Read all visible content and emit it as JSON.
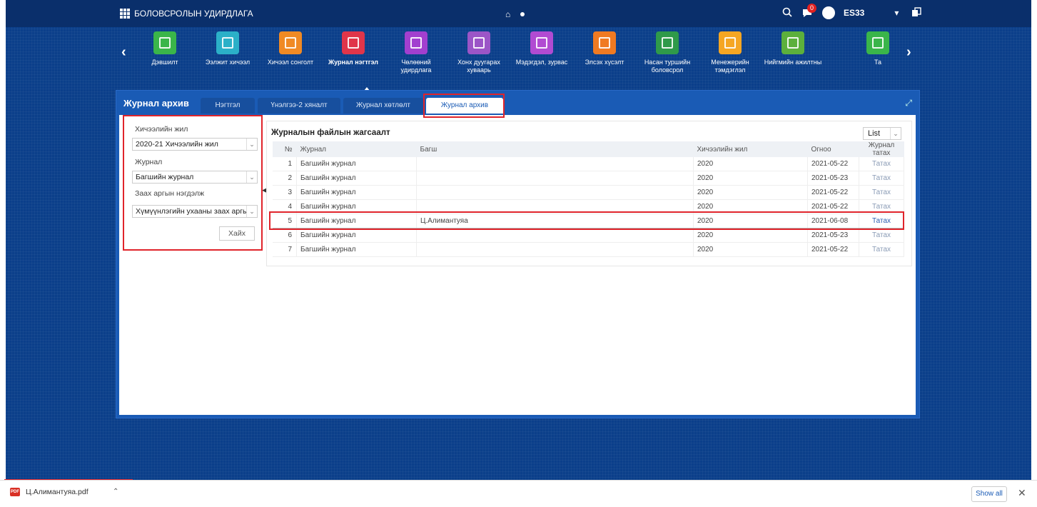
{
  "header": {
    "brand": "БОЛОВСРОЛЫН УДИРДЛАГА",
    "notification_count": "0",
    "user": "ES33"
  },
  "modules": [
    {
      "label": "Дэвшилт",
      "color": "#3ab54a"
    },
    {
      "label": "Ээлжит хичээл",
      "color": "#2bb0c8"
    },
    {
      "label": "Хичээл сонголт",
      "color": "#f08a24"
    },
    {
      "label": "Журнал нэгтгэл",
      "color": "#e0354a"
    },
    {
      "label": "Чөлөөний удирдлага",
      "color": "#a23fcf"
    },
    {
      "label": "Хонх дуугарах хуваарь",
      "color": "#9b55c7"
    },
    {
      "label": "Мэдэгдэл, зурвас",
      "color": "#b14bd2"
    },
    {
      "label": "Элсэх хүсэлт",
      "color": "#f07a22"
    },
    {
      "label": "Насан туршийн боловсрол",
      "color": "#2f9a4a"
    },
    {
      "label": "Менежерийн тэмдэглэл",
      "color": "#f5a623"
    },
    {
      "label": "Нийгмийн ажилтны",
      "color": "#5cb03c"
    },
    {
      "label": "Та",
      "color": "#3ab54a"
    }
  ],
  "panel": {
    "title": "Журнал архив",
    "tabs": [
      "Нэгтгэл",
      "Үнэлгээ-2 хяналт",
      "Журнал хөтлөлт",
      "Журнал архив"
    ]
  },
  "filter": {
    "year_label": "Хичээлийн жил",
    "year_value": "2020-21 Хичээлийн жил",
    "journal_label": "Журнал",
    "journal_value": "Багшийн журнал",
    "method_label": "Заах аргын нэгдэлж",
    "method_value": "Хүмүүнлэгийн ухааны заах аргы",
    "search_button": "Хайх"
  },
  "list": {
    "title": "Журналын файлын жагсаалт",
    "view_mode": "List",
    "columns": [
      "№",
      "Журнал",
      "Багш",
      "Хичээлийн жил",
      "Огноо",
      "Журнал татах"
    ],
    "rows": [
      [
        "1",
        "Багшийн журнал",
        "",
        "2020",
        "2021-05-22",
        "Татах"
      ],
      [
        "2",
        "Багшийн журнал",
        "",
        "2020",
        "2021-05-23",
        "Татах"
      ],
      [
        "3",
        "Багшийн журнал",
        "",
        "2020",
        "2021-05-22",
        "Татах"
      ],
      [
        "4",
        "Багшийн журнал",
        "",
        "2020",
        "2021-05-22",
        "Татах"
      ],
      [
        "5",
        "Багшийн журнал",
        "Ц.Алимантуяа",
        "2020",
        "2021-06-08",
        "Татах"
      ],
      [
        "6",
        "Багшийн журнал",
        "",
        "2020",
        "2021-05-23",
        "Татах"
      ],
      [
        "7",
        "Багшийн журнал",
        "",
        "2020",
        "2021-05-22",
        "Татах"
      ]
    ]
  },
  "downloads": {
    "file_name": "Ц.Алимантуяа.pdf",
    "file_icon_text": "PDF",
    "show_all": "Show all"
  }
}
